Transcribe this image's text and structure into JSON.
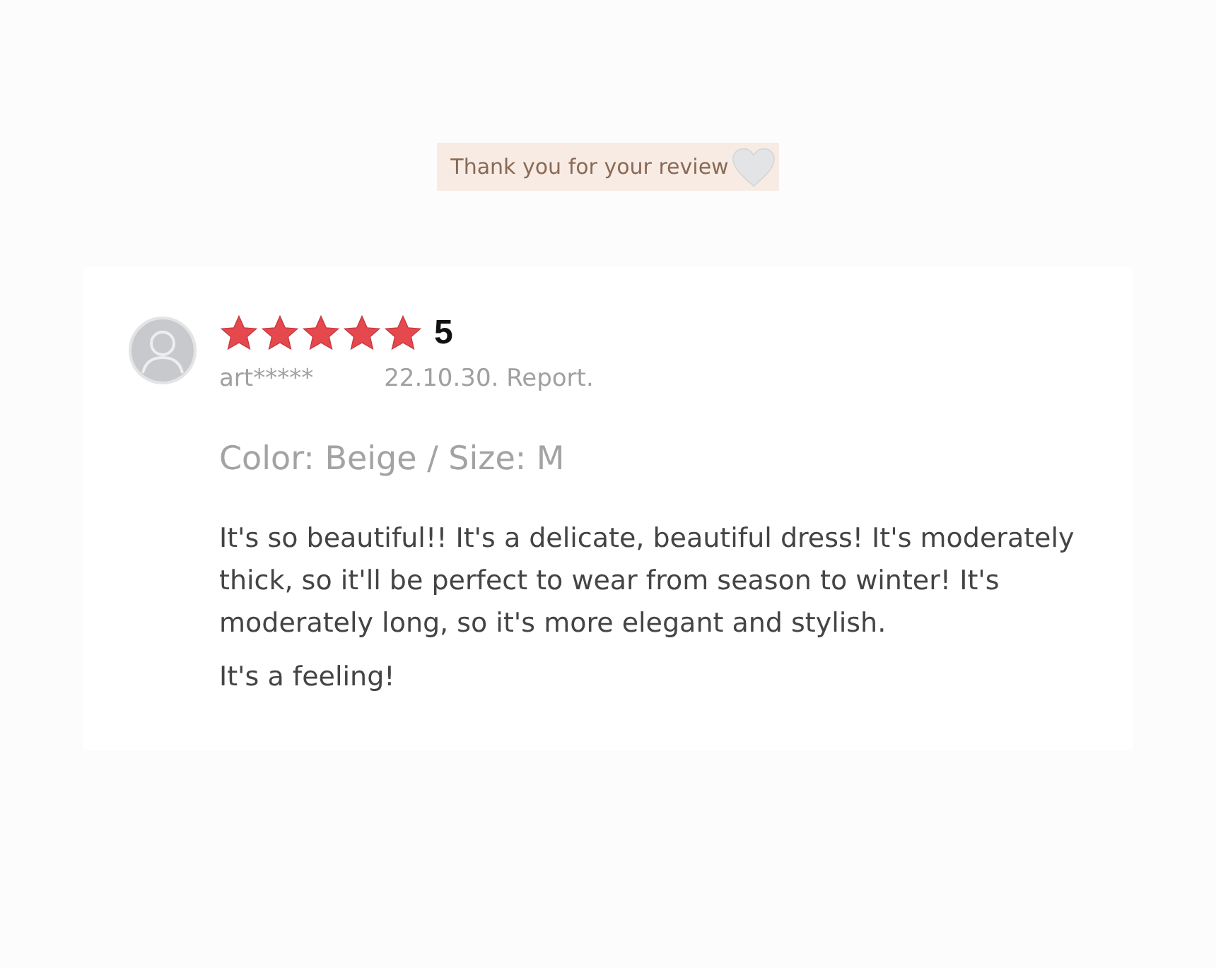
{
  "banner": {
    "text": "Thank you for your review"
  },
  "review": {
    "stars": 5,
    "rating": "5",
    "user": "art*****",
    "date": "22.10.30. Report.",
    "option": "Color: Beige / Size: M",
    "paragraphs": [
      "It's so beautiful!! It's a delicate, beautiful dress! It's moderately thick, so it'll be perfect to wear from season to winter! It's moderately long, so it's more elegant and stylish.",
      "It's a feeling!"
    ]
  }
}
